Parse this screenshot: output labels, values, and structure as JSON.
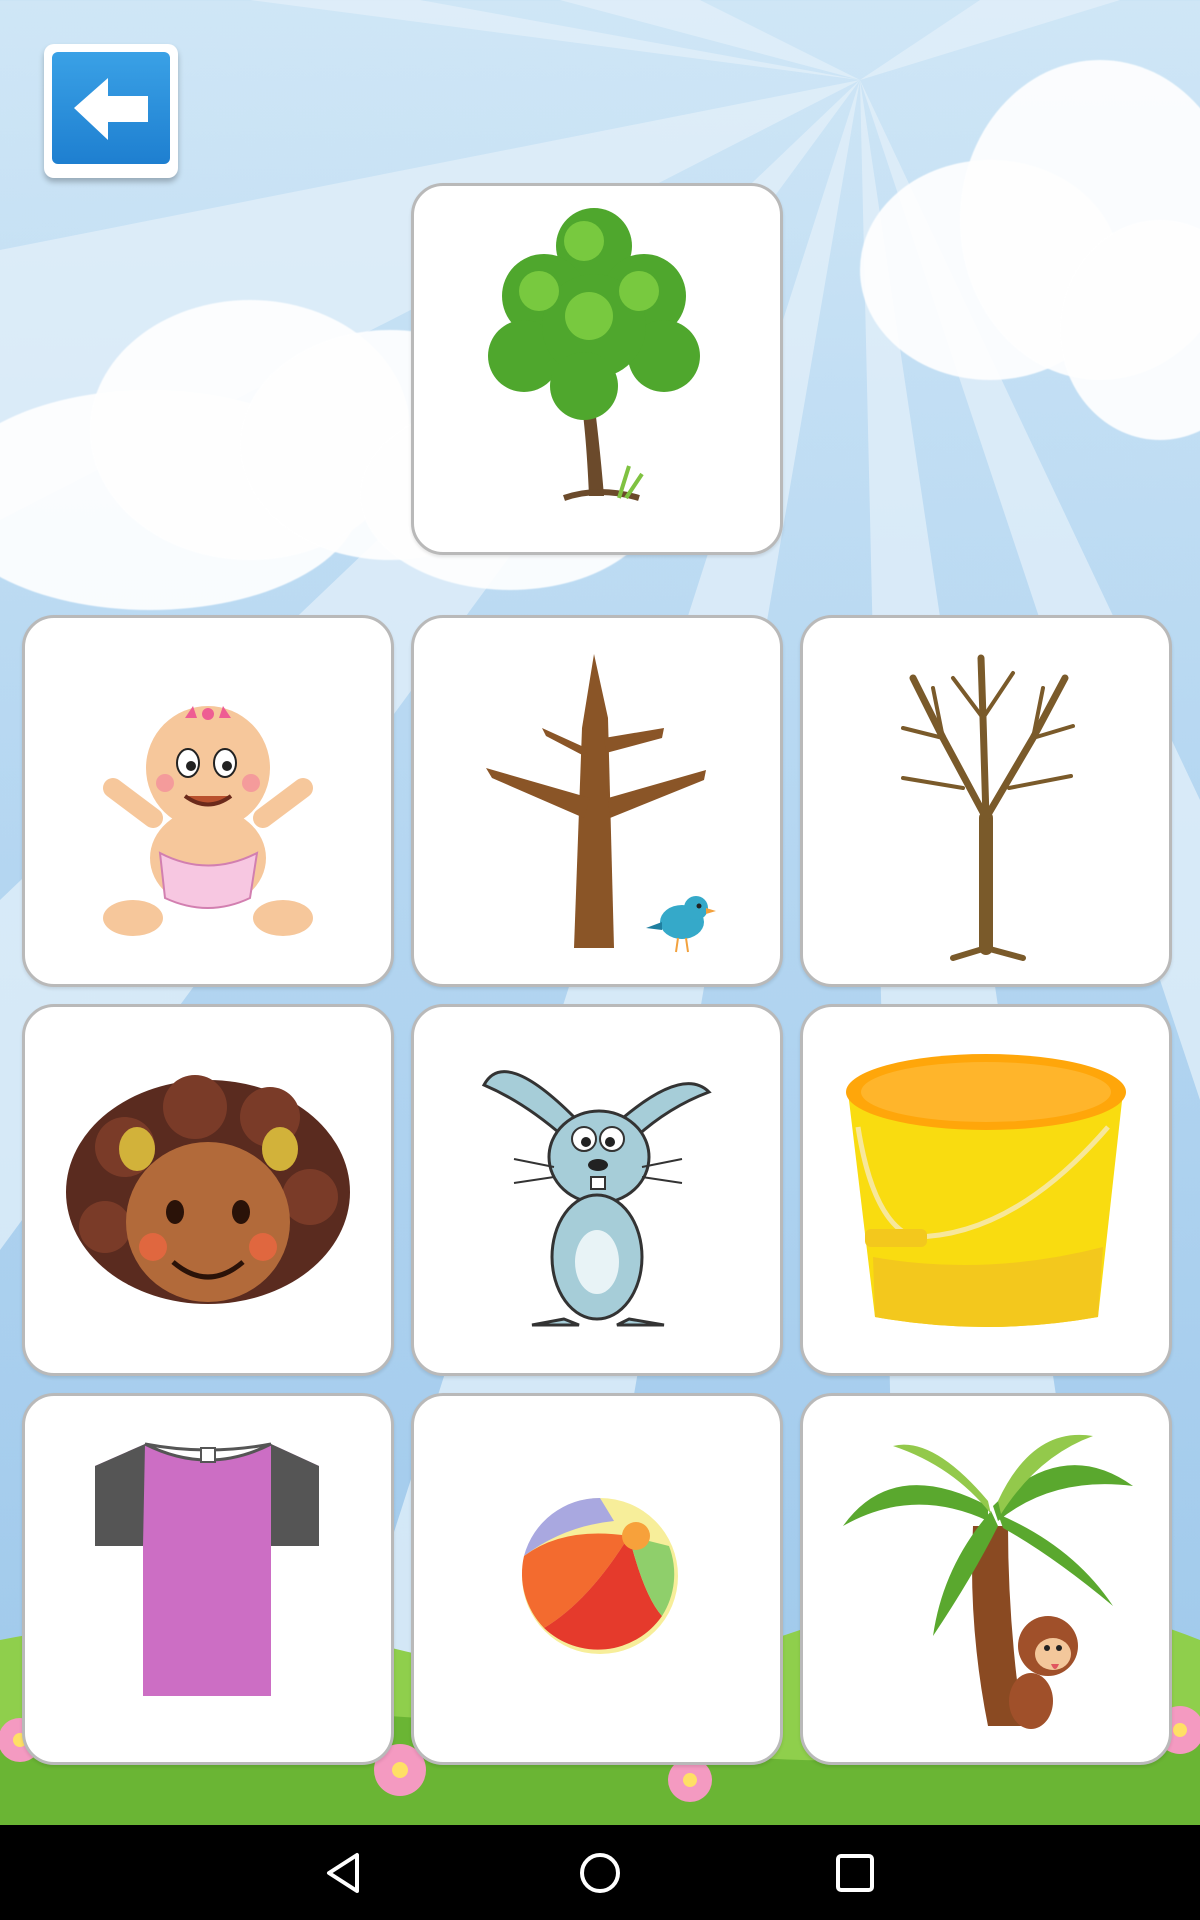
{
  "app": {
    "screen": "picture-match-game"
  },
  "top_bar": {
    "back_icon": "arrow-left-icon"
  },
  "target_card": {
    "picture": "green-leafy-tree"
  },
  "choices": [
    {
      "picture": "baby-girl-in-diaper"
    },
    {
      "picture": "bare-trunk-with-bird"
    },
    {
      "picture": "bare-branched-tree"
    },
    {
      "picture": "girl-face-curly-hair"
    },
    {
      "picture": "blue-rabbit"
    },
    {
      "picture": "yellow-bucket"
    },
    {
      "picture": "purple-t-shirt"
    },
    {
      "picture": "beach-ball"
    },
    {
      "picture": "palm-tree-with-monkey"
    }
  ],
  "nav_bar": {
    "back": "triangle-back-icon",
    "home": "circle-home-icon",
    "recents": "square-recents-icon"
  },
  "colors": {
    "sky": "#b9d9f2",
    "back_button": "#1e7fd0",
    "card_border": "#b9b9b9",
    "nav_bar": "#000000"
  }
}
